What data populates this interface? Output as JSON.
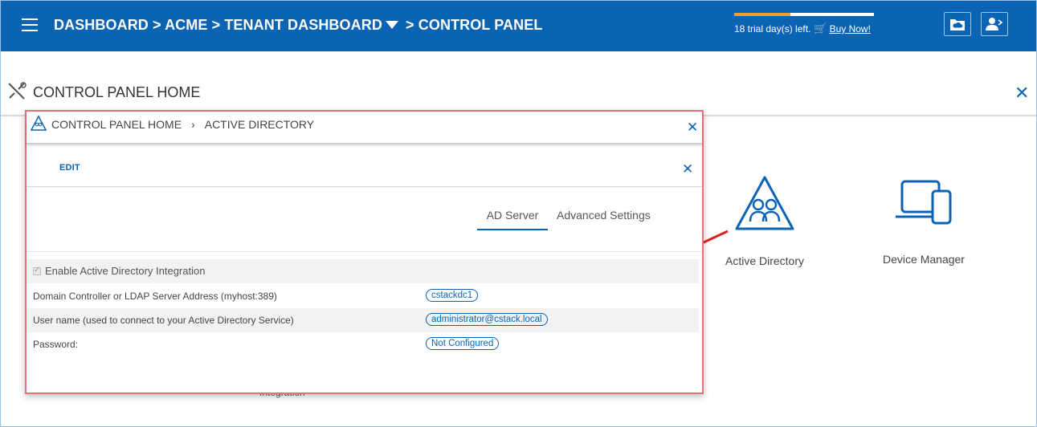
{
  "header": {
    "breadcrumb": {
      "item1": "DASHBOARD",
      "sep1": ">",
      "item2": "ACME",
      "sep2": ">",
      "item3": "TENANT DASHBOARD",
      "sep3": ">",
      "item4": "CONTROL PANEL"
    },
    "trial": {
      "text": "18 trial day(s) left.",
      "buy_label": "Buy Now!",
      "progress": 0.4
    }
  },
  "page": {
    "title": "CONTROL PANEL HOME",
    "tiles": [
      {
        "label": "Active Directory",
        "icon": "active-directory-icon"
      },
      {
        "label": "Device Manager",
        "icon": "device-manager-icon"
      }
    ],
    "bg_partial_label": "Integration"
  },
  "popup": {
    "breadcrumb": {
      "item1": "CONTROL PANEL HOME",
      "item2": "ACTIVE DIRECTORY"
    },
    "edit_label": "EDIT",
    "tabs": [
      {
        "label": "AD Server",
        "active": true
      },
      {
        "label": "Advanced Settings",
        "active": false
      }
    ],
    "enable_label": "Enable Active Directory Integration",
    "enable_checked": true,
    "fields": [
      {
        "label": "Domain Controller or LDAP Server Address (myhost:389)",
        "value": "cstackdc1"
      },
      {
        "label": "User name (used to connect to your Active Directory Service)",
        "value": "administrator@cstack.local"
      },
      {
        "label": "Password:",
        "value": "Not Configured"
      }
    ]
  },
  "colors": {
    "brand": "#0b63b4",
    "accent": "#f39c27",
    "highlight_border": "#e8707a",
    "annotation_arrow": "#e02020"
  }
}
